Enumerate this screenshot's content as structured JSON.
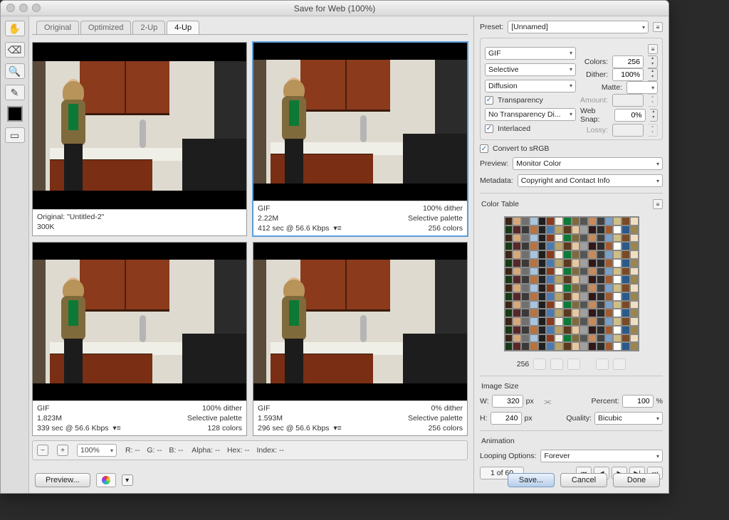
{
  "title": "Save for Web (100%)",
  "tabs": [
    "Original",
    "Optimized",
    "2-Up",
    "4-Up"
  ],
  "active_tab": "4-Up",
  "panels": [
    {
      "name": "Original: \"Untitled-2\"",
      "size": "300K",
      "dither": "",
      "palette": "",
      "time": "",
      "colors": ""
    },
    {
      "name": "GIF",
      "size": "2.22M",
      "dither": "100% dither",
      "palette": "Selective palette",
      "time": "412 sec @ 56.6 Kbps",
      "colors": "256 colors",
      "selected": true
    },
    {
      "name": "GIF",
      "size": "1.823M",
      "dither": "100% dither",
      "palette": "Selective palette",
      "time": "339 sec @ 56.6 Kbps",
      "colors": "128 colors"
    },
    {
      "name": "GIF",
      "size": "1.593M",
      "dither": "0% dither",
      "palette": "Selective palette",
      "time": "296 sec @ 56.6 Kbps",
      "colors": "256 colors"
    }
  ],
  "status": {
    "zoom": "100%",
    "r": "R: --",
    "g": "G: --",
    "b": "B: --",
    "alpha": "Alpha: --",
    "hex": "Hex: --",
    "index": "Index: --"
  },
  "footer": {
    "preview": "Preview...",
    "save": "Save...",
    "cancel": "Cancel",
    "done": "Done"
  },
  "preset": {
    "label": "Preset:",
    "value": "[Unnamed]"
  },
  "opts": {
    "format": "GIF",
    "reduction": "Selective",
    "colors_label": "Colors:",
    "colors": "256",
    "dither_method": "Diffusion",
    "dither_label": "Dither:",
    "dither": "100%",
    "transparency_label": "Transparency",
    "transparency": true,
    "matte_label": "Matte:",
    "matte": "",
    "trans_dither": "No Transparency Di...",
    "amount_label": "Amount:",
    "amount": "",
    "interlaced_label": "Interlaced",
    "interlaced": true,
    "websnap_label": "Web Snap:",
    "websnap": "0%",
    "lossy_label": "Lossy:",
    "lossy": ""
  },
  "convert": {
    "label": "Convert to sRGB",
    "on": true
  },
  "preview_select": {
    "label": "Preview:",
    "value": "Monitor Color"
  },
  "metadata": {
    "label": "Metadata:",
    "value": "Copyright and Contact Info"
  },
  "color_table": {
    "title": "Color Table",
    "count": "256"
  },
  "image_size": {
    "title": "Image Size",
    "w_label": "W:",
    "w": "320",
    "h_label": "H:",
    "h": "240",
    "px": "px",
    "percent_label": "Percent:",
    "percent": "100",
    "percent_unit": "%",
    "quality_label": "Quality:",
    "quality": "Bicubic"
  },
  "animation": {
    "title": "Animation",
    "loop_label": "Looping Options:",
    "loop": "Forever",
    "frame": "1 of 60"
  }
}
